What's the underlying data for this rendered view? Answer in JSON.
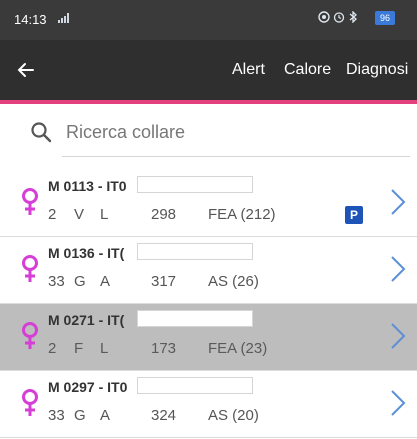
{
  "status_bar": {
    "time": "14:13",
    "signal_label": "4G",
    "battery": "96"
  },
  "app_bar": {
    "actions": [
      "Alert",
      "Calore",
      "Diagnosi"
    ]
  },
  "search": {
    "placeholder": "Ricerca collare",
    "value": ""
  },
  "animals": [
    {
      "title": "M 0113 - IT0",
      "n": "2",
      "code1": "V",
      "code2": "L",
      "days": "298",
      "status": "FEA (212)",
      "badge": "P",
      "selected": false
    },
    {
      "title": "M 0136 - IT(",
      "n": "33",
      "code1": "G",
      "code2": "A",
      "days": "317",
      "status": "AS (26)",
      "badge": "",
      "selected": false
    },
    {
      "title": "M 0271 - IT(",
      "n": "2",
      "code1": "F",
      "code2": "L",
      "days": "173",
      "status": "FEA (23)",
      "badge": "",
      "selected": true
    },
    {
      "title": "M 0297 - IT0",
      "n": "33",
      "code1": "G",
      "code2": "A",
      "days": "324",
      "status": "AS (20)",
      "badge": "",
      "selected": false
    }
  ],
  "colors": {
    "accent": "#e3417d",
    "female_icon": "#d63fd6",
    "chevron": "#5b8fd6",
    "badge": "#1e54b8",
    "app_bar": "#2f2f2f",
    "selected_row": "#bdbdbd"
  },
  "icons": {
    "back": "arrow-left-icon",
    "search": "search-icon",
    "sex": "female-icon",
    "row_action": "chevron-right-icon"
  }
}
